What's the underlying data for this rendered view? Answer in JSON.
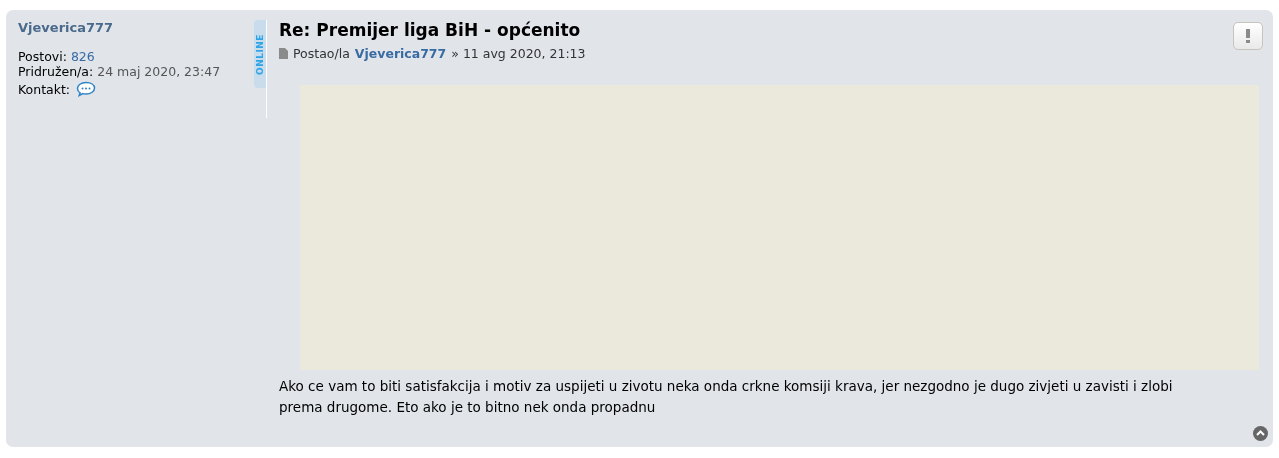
{
  "author": {
    "username": "Vjeverica777",
    "stats": [
      {
        "label": "Postovi:",
        "value": "826",
        "kind": "link"
      },
      {
        "label": "Pridružen/a:",
        "value": "24 maj 2020, 23:47",
        "kind": "text"
      }
    ],
    "contact_label": "Kontakt:",
    "online": true,
    "status": "ONLINE"
  },
  "post": {
    "title": "Re: Premijer liga BiH - općenito",
    "meta": {
      "prefix": "Postao/la",
      "author": "Vjeverica777",
      "separator": "»",
      "date": "11 avg 2020, 21:13"
    },
    "embed": {
      "kind": "placeholder"
    },
    "body": "Ako ce vam to biti satisfakcija i motiv za uspijeti u zivotu neka onda crkne komsiji krava, jer nezgodno je dugo zivjeti u zavisti i zlobi prema drugome. Eto ako je to bitno nek onda propadnu"
  }
}
